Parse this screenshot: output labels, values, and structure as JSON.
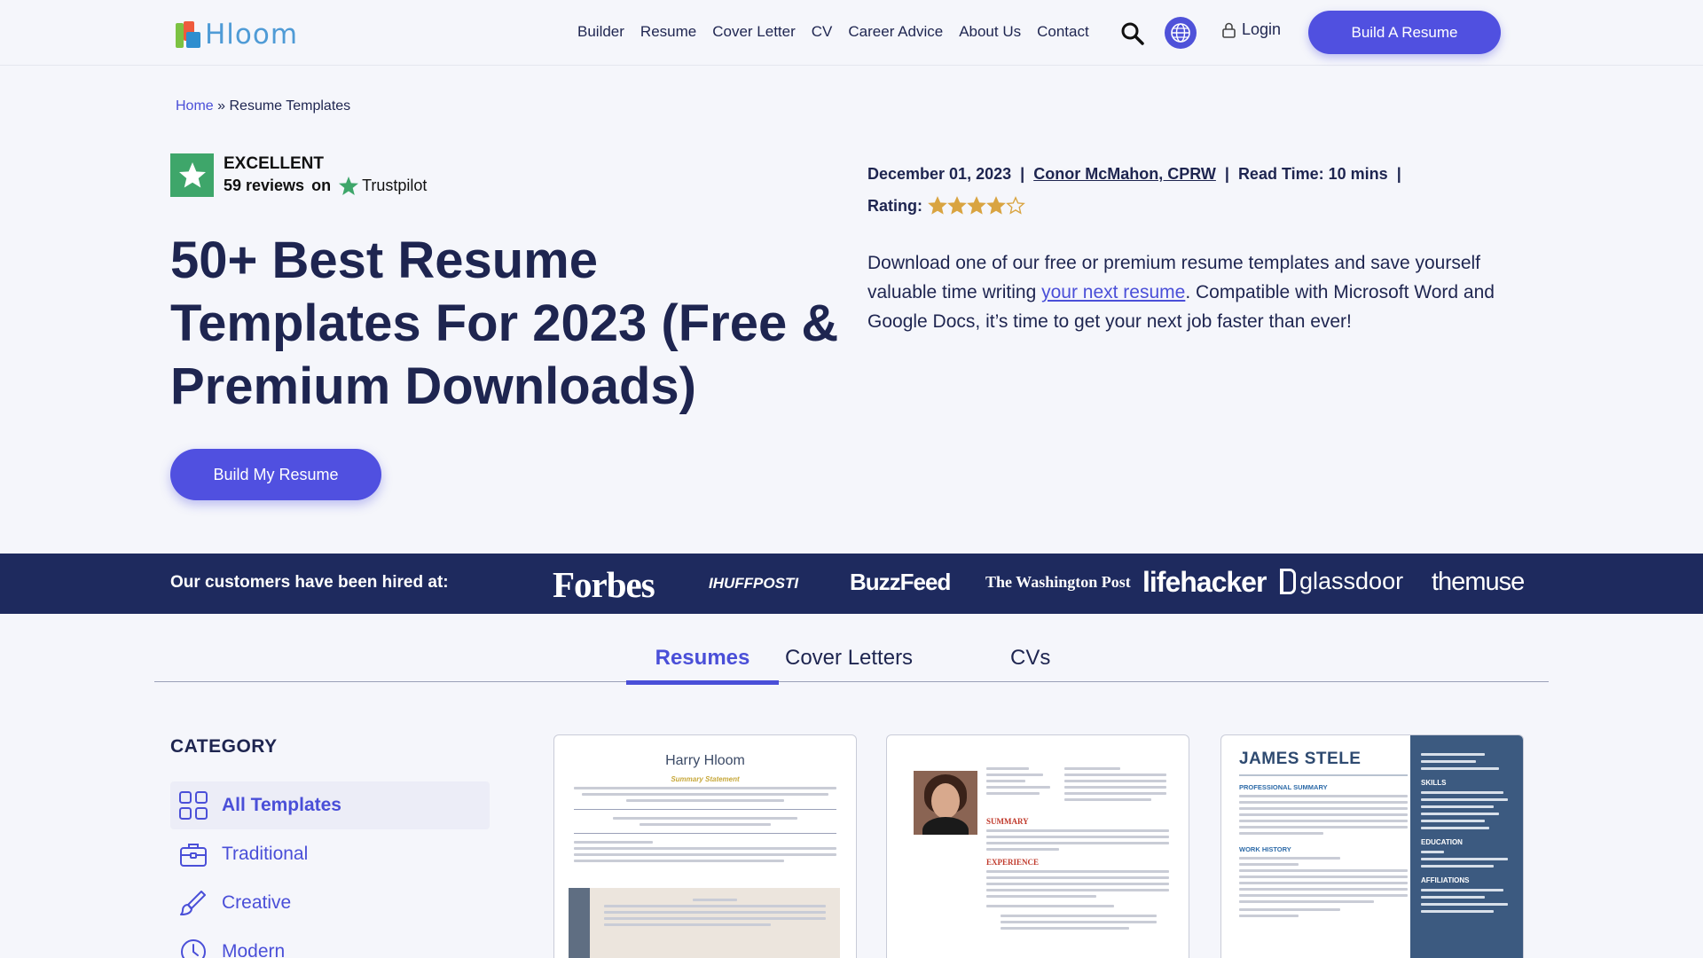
{
  "header": {
    "logo_text": "Hloom",
    "nav": [
      "Builder",
      "Resume",
      "Cover Letter",
      "CV",
      "Career Advice",
      "About Us",
      "Contact"
    ],
    "login_label": "Login",
    "build_button": "Build A Resume"
  },
  "breadcrumb": {
    "home": "Home",
    "separator": "»",
    "current": "Resume Templates"
  },
  "trustpilot": {
    "rating_word": "EXCELLENT",
    "reviews": "59 reviews",
    "on": "on",
    "brand": "Trustpilot"
  },
  "hero": {
    "title": "50+ Best Resume Templates For 2023 (Free & Premium Downloads)",
    "button": "Build My Resume"
  },
  "meta": {
    "date": "December 01, 2023",
    "author": "Conor McMahon, CPRW",
    "read_time": "Read Time: 10 mins",
    "rating_label": "Rating:",
    "rating_value": 4
  },
  "intro": {
    "part1": "Download one of our free or premium resume templates and save yourself valuable time writing ",
    "link": "your next resume",
    "part2": ". Compatible with Microsoft Word and Google Docs, it’s time to get your next job faster than ever!"
  },
  "hired": {
    "label": "Our customers have been hired at:",
    "brands": [
      "Forbes",
      "IHUFFPOSTI",
      "BuzzFeed",
      "The Washington Post",
      "lifehacker",
      "glassdoor",
      "themuse"
    ]
  },
  "tabs": [
    "Resumes",
    "Cover Letters",
    "CVs"
  ],
  "category": {
    "title": "CATEGORY",
    "items": [
      "All Templates",
      "Traditional",
      "Creative",
      "Modern"
    ]
  },
  "cards": {
    "c1": {
      "name": "Harry Hloom",
      "subtitle": "Summary Statement"
    },
    "c2": {
      "summary": "SUMMARY",
      "experience": "EXPERIENCE"
    },
    "c3": {
      "name": "JAMES STELE",
      "summary": "PROFESSIONAL SUMMARY",
      "history": "WORK HISTORY",
      "skills": "SKILLS",
      "education": "EDUCATION",
      "affiliations": "AFFILIATIONS"
    }
  },
  "colors": {
    "accent": "#5050e0",
    "navy": "#1e2a5e",
    "text": "#1e2550",
    "trustpilot_green": "#3ea66a",
    "star": "#d9a441"
  }
}
